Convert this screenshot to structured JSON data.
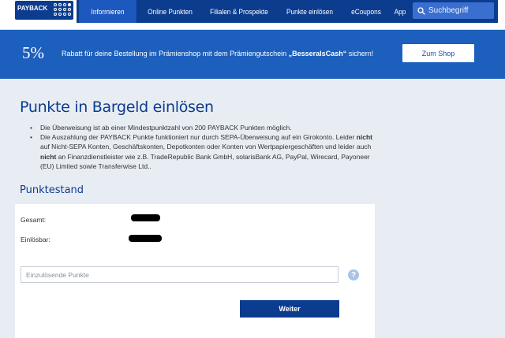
{
  "header": {
    "logo_text": "PAYBACK",
    "nav": [
      {
        "label": "Informieren",
        "active": true
      },
      {
        "label": "Online Punkten",
        "active": false
      },
      {
        "label": "Filialen & Prospekte",
        "active": false
      },
      {
        "label": "Punkte einlösen",
        "active": false
      },
      {
        "label": "eCoupons",
        "active": false
      },
      {
        "label": "App",
        "active": false
      }
    ],
    "search_placeholder": "Suchbegriff",
    "colors": {
      "nav_bg": "#0c3c8e",
      "nav_active": "#1d58bf",
      "search_bg": "#3a6fd0"
    }
  },
  "promo": {
    "percent": "5%",
    "text_prefix": "Rabatt für deine Bestellung im Prämienshop mit dem Prämiengutschein ",
    "code": "„BesseralsCash“",
    "text_suffix": " sichern!",
    "button_label": "Zum Shop",
    "color": "#1c5fbd"
  },
  "main": {
    "title": "Punkte in Bargeld einlösen",
    "bullet1": "Die Überweisung ist ab einer Mindestpunktzahl von 200 PAYBACK Punkten möglich.",
    "bullet2": {
      "part1": "Die Auszahlung der PAYBACK Punkte funktioniert nur durch SEPA-Überweisung auf ein Girokonto. Leider ",
      "bold1": "nicht",
      "part2": " auf Nicht-SEPA Konten, Geschäftskonten, Depotkonten oder Konten von Wertpapiergeschäften und leider auch ",
      "bold2": "nicht",
      "part3": " an Finanzdienstleister wie z.B. TradeRepublic Bank GmbH, solarisBank AG, PayPal, Wirecard, Payoneer (EU) Limited sowie Transferwise Ltd.."
    },
    "section_title": "Punktestand",
    "rows": [
      {
        "label": "Gesamt:"
      },
      {
        "label": "Einlösbar:"
      }
    ],
    "input_placeholder": "Einzulösende Punkte",
    "help_icon": "question-circle-icon",
    "submit_label": "Weiter"
  }
}
